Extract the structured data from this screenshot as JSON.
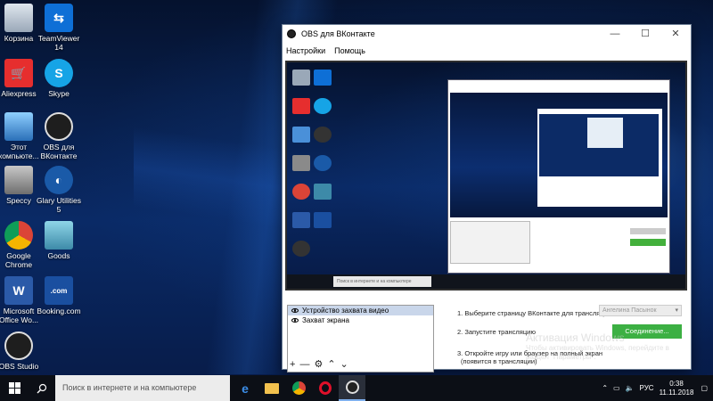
{
  "desktop": {
    "icons": [
      {
        "label": "Корзина"
      },
      {
        "label": "TeamViewer\n14"
      },
      {
        "label": "Aliexpress"
      },
      {
        "label": "Skype"
      },
      {
        "label": "Этот\nкомпьюте..."
      },
      {
        "label": "OBS для\nВКонтакте"
      },
      {
        "label": "Speccy"
      },
      {
        "label": "Glary Utilities\n5"
      },
      {
        "label": "Google\nChrome"
      },
      {
        "label": "Goods"
      },
      {
        "label": "Microsoft\nOffice Wo..."
      },
      {
        "label": "Booking.com"
      },
      {
        "label": "OBS Studio"
      }
    ]
  },
  "window": {
    "title": "OBS для ВКонтакте",
    "minimize": "—",
    "maximize": "☐",
    "close": "✕",
    "menu": [
      "Настройки",
      "Помощь"
    ]
  },
  "preview": {
    "search_placeholder": "Поиск в интернете и на компьютере"
  },
  "sources": {
    "items": [
      "Устройство захвата видео",
      "Захват экрана"
    ],
    "toolbar": [
      "+",
      "—",
      "⚙",
      "⌃",
      "⌄"
    ]
  },
  "steps": {
    "step1": "1. Выберите страницу ВКонтакте для трансляции",
    "step2": "2. Запустите трансляцию",
    "step3_line1": "3. Откройте игру или браузер на полный экран",
    "step3_line2": "(появится в трансляции)",
    "select_value": "Ангелина Пасынок",
    "connect_button": "Соединение..."
  },
  "activation": {
    "title": "Активация Windows",
    "subtitle": "Чтобы активировать Windows, перейдите в раздел \"Параметры\"."
  },
  "taskbar": {
    "search_placeholder": "Поиск в интернете и на компьютере",
    "language": "РУС",
    "time": "0:38",
    "date": "11.11.2018"
  },
  "colors": {
    "accent_green": "#3cb043",
    "taskbar": "#0c0f16",
    "selection": "#c9d6ea"
  }
}
